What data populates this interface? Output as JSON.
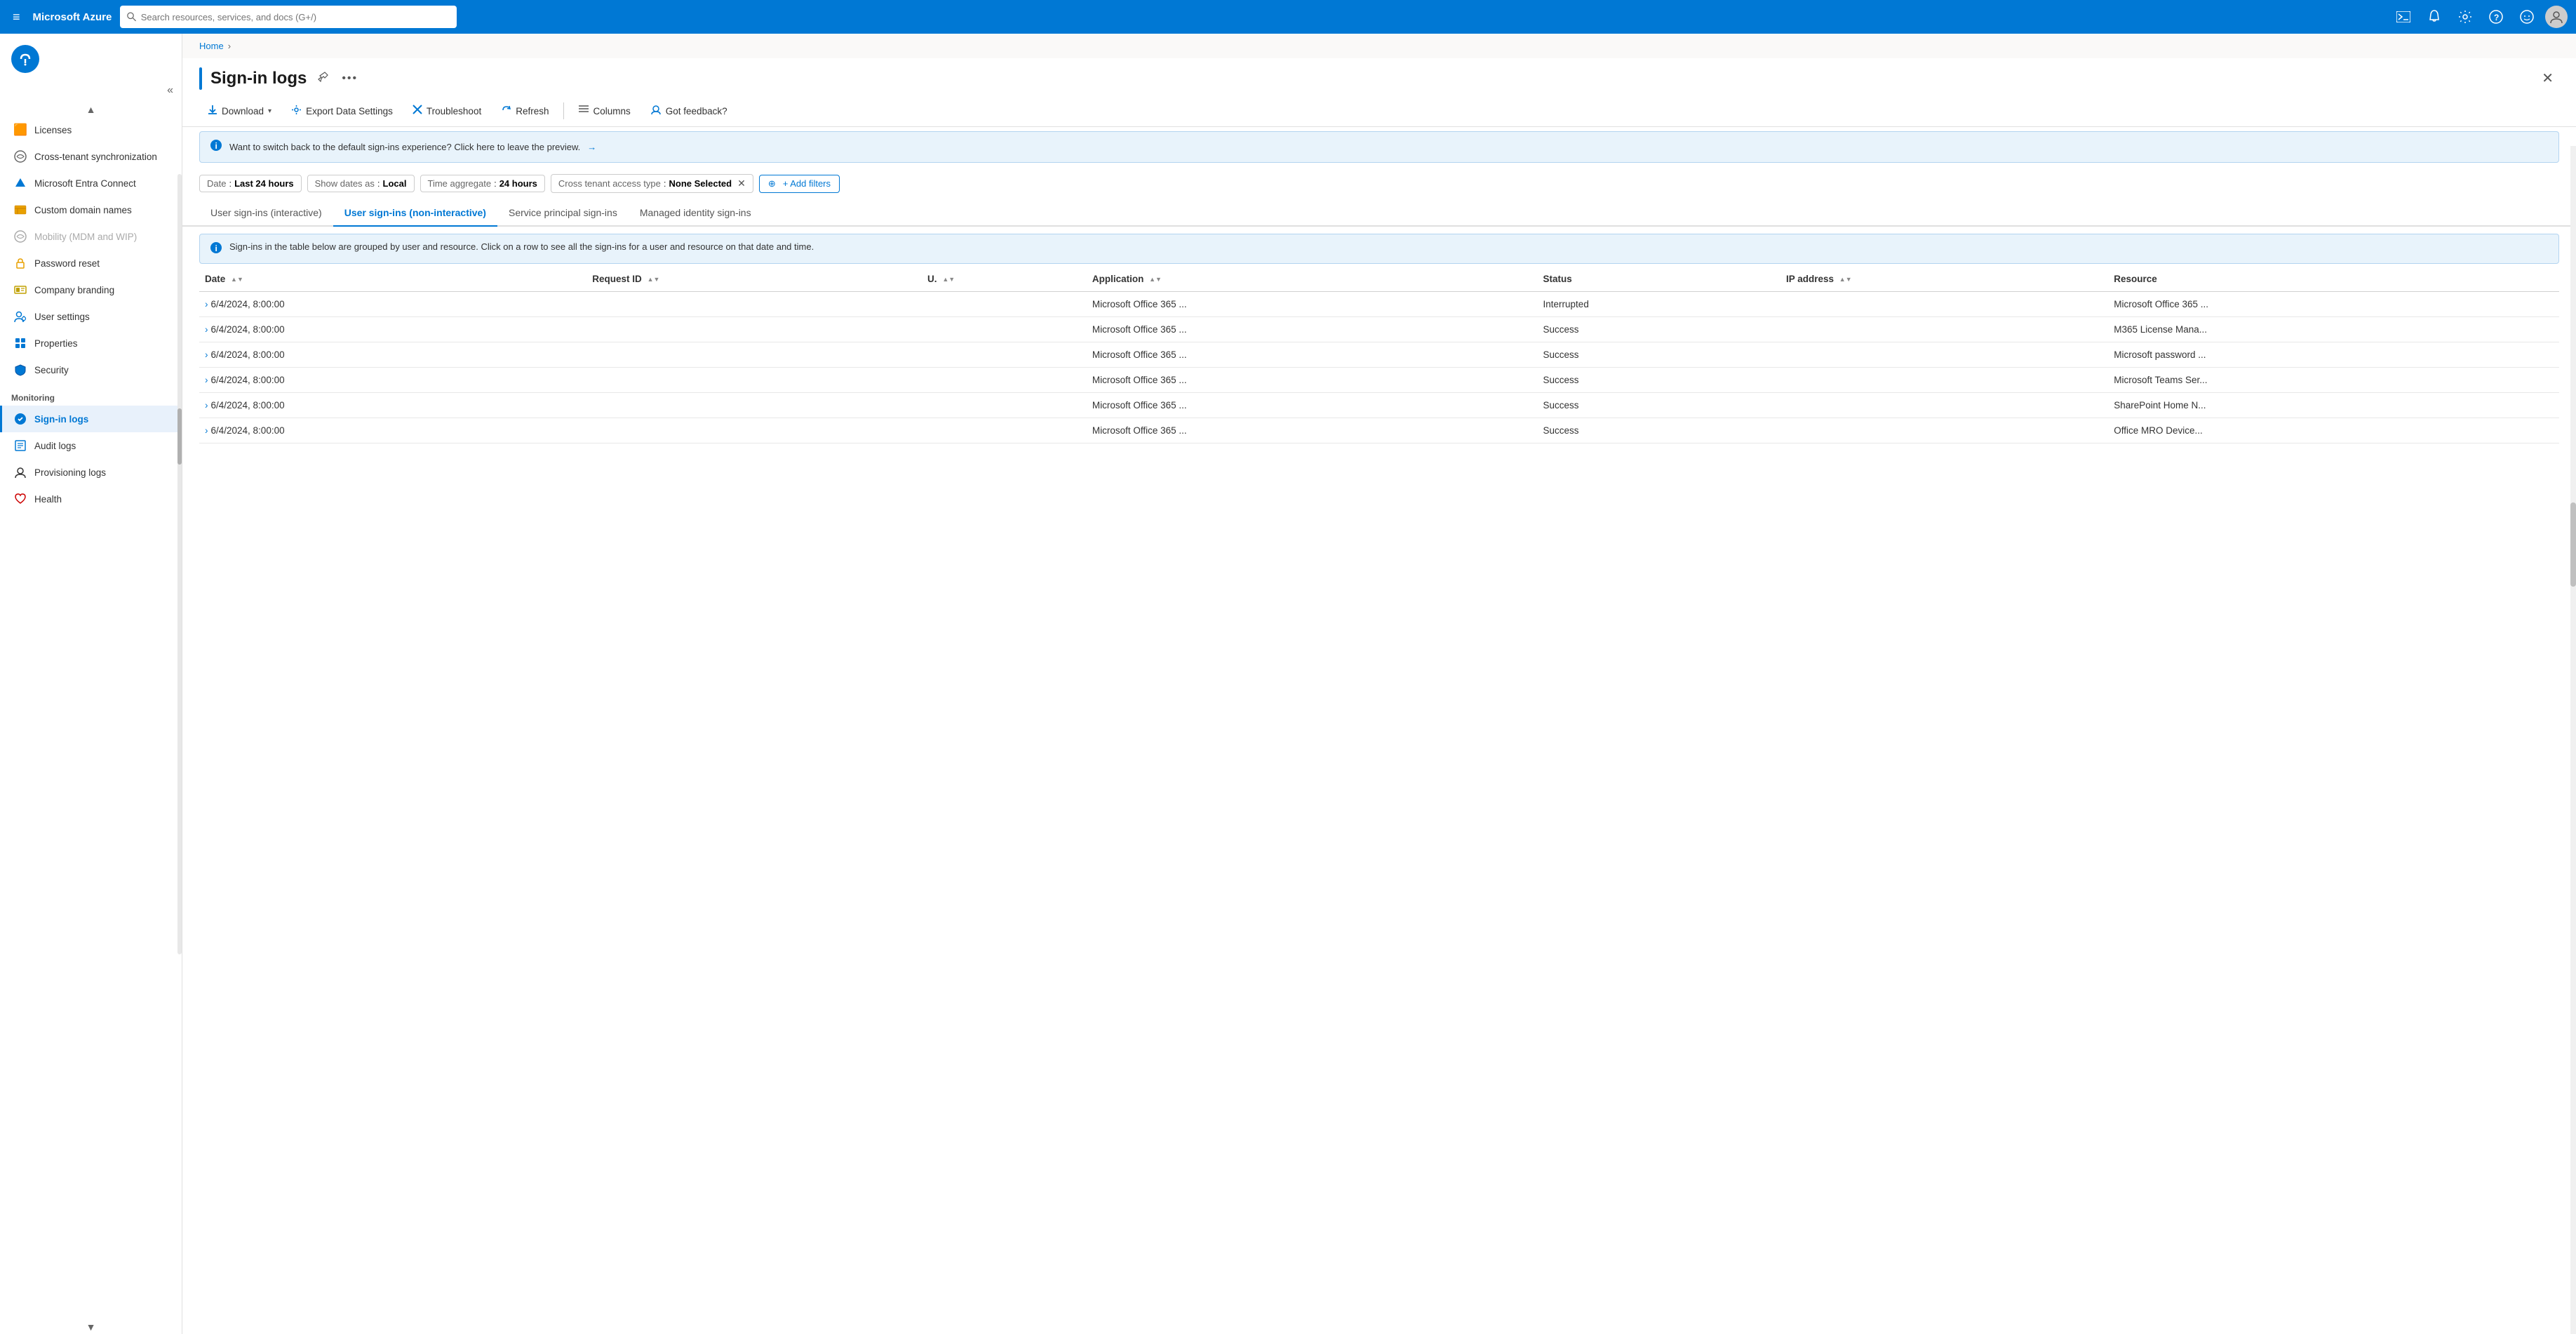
{
  "topbar": {
    "menu_icon": "≡",
    "title": "Microsoft Azure",
    "search_placeholder": "Search resources, services, and docs (G+/)",
    "icons": [
      {
        "name": "terminal-icon",
        "symbol": "⬛",
        "label": "Cloud Shell"
      },
      {
        "name": "bell-icon",
        "symbol": "🔔",
        "label": "Notifications"
      },
      {
        "name": "gear-icon",
        "symbol": "⚙",
        "label": "Settings"
      },
      {
        "name": "help-icon",
        "symbol": "❓",
        "label": "Help"
      },
      {
        "name": "feedback-icon",
        "symbol": "😊",
        "label": "Feedback"
      }
    ]
  },
  "breadcrumb": {
    "home": "Home",
    "separator": "›"
  },
  "page": {
    "title": "Sign-in logs",
    "pin_icon": "📌",
    "more_icon": "•••",
    "close_icon": "✕"
  },
  "toolbar": {
    "download_label": "Download",
    "download_icon": "↓",
    "export_label": "Export Data Settings",
    "export_icon": "⚙",
    "troubleshoot_label": "Troubleshoot",
    "troubleshoot_icon": "✕",
    "refresh_label": "Refresh",
    "refresh_icon": "↻",
    "columns_label": "Columns",
    "columns_icon": "≡",
    "feedback_label": "Got feedback?",
    "feedback_icon": "👤"
  },
  "info_banner": {
    "icon": "ℹ",
    "text": "Want to switch back to the default sign-ins experience? Click here to leave the preview.",
    "arrow": "→"
  },
  "filters": {
    "date_label": "Date",
    "date_value": "Last 24 hours",
    "show_dates_label": "Show dates as",
    "show_dates_value": "Local",
    "time_aggregate_label": "Time aggregate",
    "time_aggregate_value": "24 hours",
    "cross_tenant_label": "Cross tenant access type",
    "cross_tenant_value": "None Selected",
    "add_filter_label": "+ Add filters"
  },
  "tabs": [
    {
      "id": "interactive",
      "label": "User sign-ins (interactive)",
      "active": false
    },
    {
      "id": "non-interactive",
      "label": "User sign-ins (non-interactive)",
      "active": true
    },
    {
      "id": "service-principal",
      "label": "Service principal sign-ins",
      "active": false
    },
    {
      "id": "managed-identity",
      "label": "Managed identity sign-ins",
      "active": false
    }
  ],
  "table_info_banner": {
    "icon": "ℹ",
    "text": "Sign-ins in the table below are grouped by user and resource. Click on a row to see all the sign-ins for a user and resource on that date and time."
  },
  "table": {
    "columns": [
      {
        "id": "date",
        "label": "Date",
        "sortable": true
      },
      {
        "id": "request_id",
        "label": "Request ID",
        "sortable": true
      },
      {
        "id": "user",
        "label": "U.",
        "sortable": true
      },
      {
        "id": "application",
        "label": "Application",
        "sortable": true
      },
      {
        "id": "status",
        "label": "Status",
        "sortable": false
      },
      {
        "id": "ip_address",
        "label": "IP address",
        "sortable": true
      },
      {
        "id": "resource",
        "label": "Resource",
        "sortable": false
      }
    ],
    "rows": [
      {
        "date": "6/4/2024, 8:00:00",
        "request_id": "",
        "user": "",
        "application": "Microsoft Office 365 ...",
        "status": "Interrupted",
        "ip_address": "",
        "resource": "Microsoft Office 365 ..."
      },
      {
        "date": "6/4/2024, 8:00:00",
        "request_id": "",
        "user": "",
        "application": "Microsoft Office 365 ...",
        "status": "Success",
        "ip_address": "",
        "resource": "M365 License Mana..."
      },
      {
        "date": "6/4/2024, 8:00:00",
        "request_id": "",
        "user": "",
        "application": "Microsoft Office 365 ...",
        "status": "Success",
        "ip_address": "",
        "resource": "Microsoft password ..."
      },
      {
        "date": "6/4/2024, 8:00:00",
        "request_id": "",
        "user": "",
        "application": "Microsoft Office 365 ...",
        "status": "Success",
        "ip_address": "",
        "resource": "Microsoft Teams Ser..."
      },
      {
        "date": "6/4/2024, 8:00:00",
        "request_id": "",
        "user": "",
        "application": "Microsoft Office 365 ...",
        "status": "Success",
        "ip_address": "",
        "resource": "SharePoint Home N..."
      },
      {
        "date": "6/4/2024, 8:00:00",
        "request_id": "",
        "user": "",
        "application": "Microsoft Office 365 ...",
        "status": "Success",
        "ip_address": "",
        "resource": "Office MRO Device..."
      }
    ]
  },
  "sidebar": {
    "items_above": [
      {
        "id": "licenses",
        "label": "Licenses",
        "icon": "🟧"
      },
      {
        "id": "cross-tenant-sync",
        "label": "Cross-tenant synchronization",
        "icon": "⚙"
      },
      {
        "id": "entra-connect",
        "label": "Microsoft Entra Connect",
        "icon": "🔷"
      },
      {
        "id": "custom-domain",
        "label": "Custom domain names",
        "icon": "🟧"
      },
      {
        "id": "mobility",
        "label": "Mobility (MDM and WIP)",
        "icon": "⚙"
      },
      {
        "id": "password-reset",
        "label": "Password reset",
        "icon": "🔑"
      },
      {
        "id": "company-branding",
        "label": "Company branding",
        "icon": "📊"
      },
      {
        "id": "user-settings",
        "label": "User settings",
        "icon": "👥"
      },
      {
        "id": "properties",
        "label": "Properties",
        "icon": "📊"
      },
      {
        "id": "security",
        "label": "Security",
        "icon": "🔷"
      }
    ],
    "monitoring_section": "Monitoring",
    "monitoring_items": [
      {
        "id": "sign-in-logs",
        "label": "Sign-in logs",
        "icon": "🔵",
        "active": true
      },
      {
        "id": "audit-logs",
        "label": "Audit logs",
        "icon": "📋"
      },
      {
        "id": "provisioning-logs",
        "label": "Provisioning logs",
        "icon": "👤"
      },
      {
        "id": "health",
        "label": "Health",
        "icon": "❤"
      }
    ]
  }
}
